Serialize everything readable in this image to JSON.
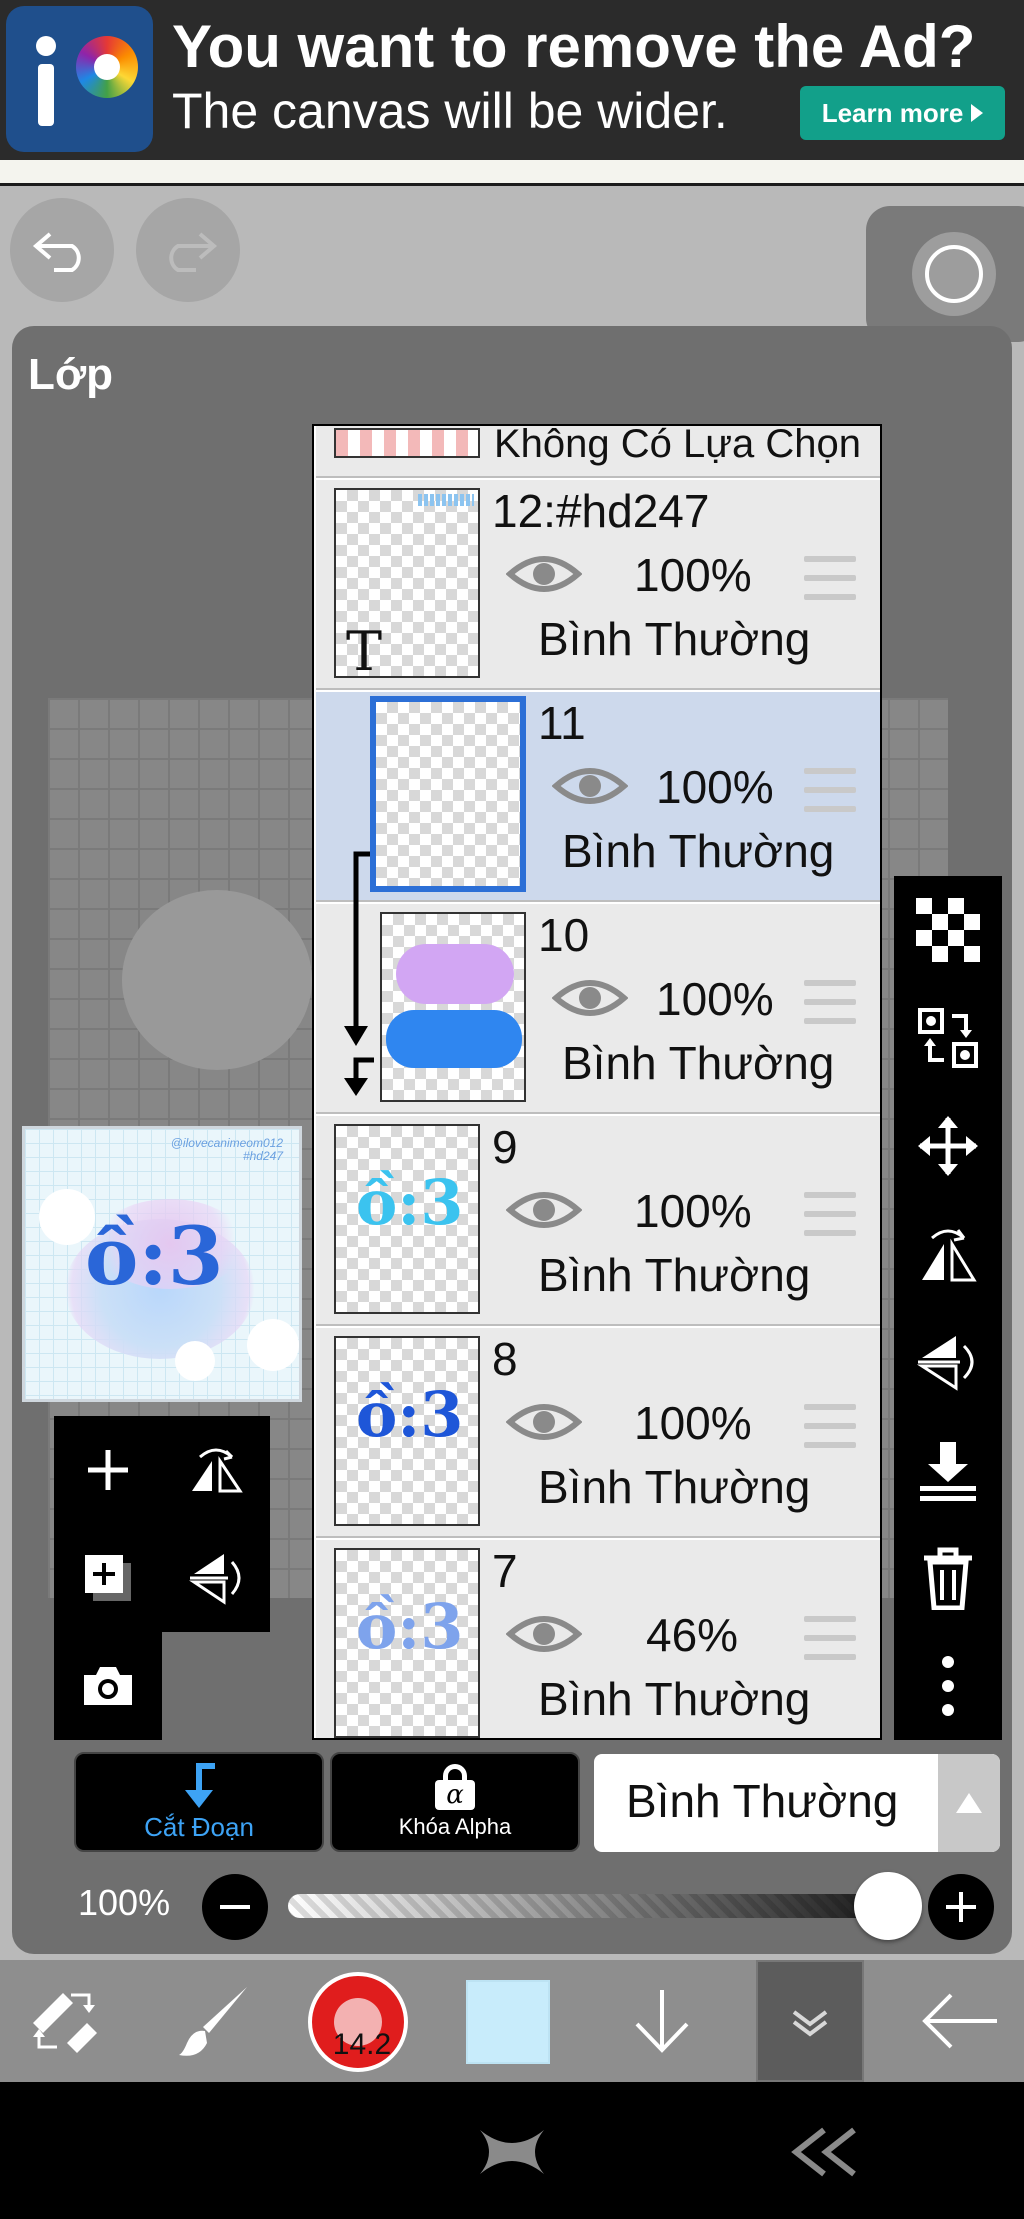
{
  "ad": {
    "title": "You want to remove the Ad?",
    "subtitle": "The canvas will be wider.",
    "learn_more": "Learn more"
  },
  "panel": {
    "title": "Lớp"
  },
  "preview": {
    "tag_line1": "@ilovecanimeom012",
    "tag_line2": "#hd247"
  },
  "layers": {
    "selection_layer": "Không Có Lựa Chọn",
    "items": [
      {
        "name": "12:#hd247",
        "opacity": "100%",
        "mode": "Bình Thường",
        "thumb_mark": "T"
      },
      {
        "name": "11",
        "opacity": "100%",
        "mode": "Bình Thường"
      },
      {
        "name": "10",
        "opacity": "100%",
        "mode": "Bình Thường"
      },
      {
        "name": "9",
        "opacity": "100%",
        "mode": "Bình Thường"
      },
      {
        "name": "8",
        "opacity": "100%",
        "mode": "Bình Thường"
      },
      {
        "name": "7",
        "opacity": "46%",
        "mode": "Bình Thường"
      }
    ]
  },
  "controls": {
    "clipping_label": "Cắt Đoạn",
    "alpha_lock_label": "Khóa Alpha",
    "alpha_symbol": "α",
    "blend_mode": "Bình Thường",
    "opacity_text": "100%",
    "opacity_value": 1.0
  },
  "bottom_bar": {
    "brush_size": "14.2",
    "color": "#c8ecfb"
  },
  "colors": {
    "selected_layer_bg": "#cdd9ec",
    "clip_accent": "#3da3f5",
    "brush_red": "#e01d1d",
    "ad_button": "#12a08a"
  }
}
